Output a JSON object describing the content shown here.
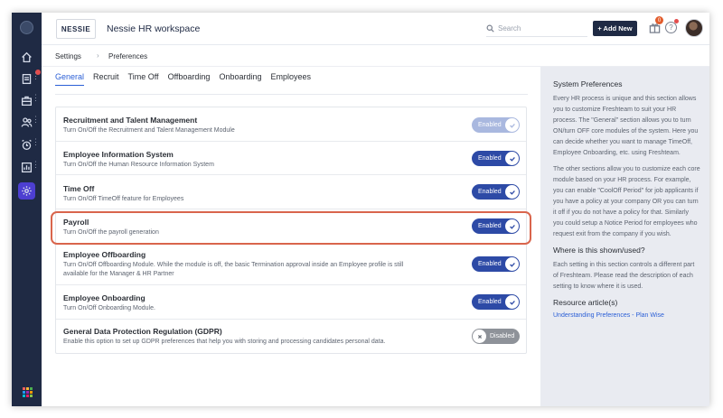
{
  "app": {
    "workspace_title": "Nessie HR workspace",
    "logo_text": "NESSIE"
  },
  "topbar": {
    "search_placeholder": "Search",
    "add_new_label": "+ Add New",
    "notification_count": "0",
    "help_glyph": "?"
  },
  "rail": {
    "icons": [
      "home-icon",
      "forms-icon",
      "briefcase-icon",
      "people-icon",
      "alarm-clock-icon",
      "report-icon",
      "settings-icon"
    ],
    "active": "settings-icon",
    "apps_grid_colors": [
      "#f25f5c",
      "#f7b538",
      "#4caf50",
      "#2196f3",
      "#9c27b0",
      "#ff9800",
      "#00bcd4",
      "#e91e63",
      "#8bc34a"
    ]
  },
  "breadcrumb": {
    "root": "Settings",
    "separator": "›",
    "current": "Preferences"
  },
  "tabs": [
    {
      "label": "General",
      "active": true
    },
    {
      "label": "Recruit",
      "active": false
    },
    {
      "label": "Time Off",
      "active": false
    },
    {
      "label": "Offboarding",
      "active": false
    },
    {
      "label": "Onboarding",
      "active": false
    },
    {
      "label": "Employees",
      "active": false
    }
  ],
  "settings": [
    {
      "title": "Recruitment and Talent Management",
      "desc": "Turn On/Off the Recruitment and Talent Management Module",
      "state": "Enabled",
      "style": "dim"
    },
    {
      "title": "Employee Information System",
      "desc": "Turn On/Off the Human Resource Information System",
      "state": "Enabled",
      "style": "on"
    },
    {
      "title": "Time Off",
      "desc": "Turn On/Off TimeOff feature for Employees",
      "state": "Enabled",
      "style": "on"
    },
    {
      "title": "Payroll",
      "desc": "Turn On/Off the payroll generation",
      "state": "Enabled",
      "style": "on"
    },
    {
      "title": "Employee Offboarding",
      "desc": "Turn On/Off Offboarding Module. While the module is off, the basic Termination approval inside an Employee profile is still available for the Manager & HR Partner",
      "state": "Enabled",
      "style": "on"
    },
    {
      "title": "Employee Onboarding",
      "desc": "Turn On/Off Onboarding Module.",
      "state": "Enabled",
      "style": "on"
    },
    {
      "title": "General Data Protection Regulation (GDPR)",
      "desc": "Enable this option to set up GDPR preferences that help you with storing and processing candidates personal data.",
      "state": "Disabled",
      "style": "off"
    }
  ],
  "colors": {
    "highlight": "#d9654c",
    "toggle_on": "#2d4aa6",
    "accent": "#2b5fd6",
    "rail": "#1f2a44"
  },
  "side": {
    "heading": "System Preferences",
    "para1": "Every HR process is unique and this section allows you to customize Freshteam to suit your HR process. The \"General\" section allows you to turn ON/turn OFF core modules of the system. Here you can decide whether you want to manage TimeOff, Employee Onboarding, etc. using Freshteam.",
    "para2": "The other sections allow you to customize each core module based on your HR process. For example, you can enable \"CoolOff Period\" for job applicants if you have a policy at your company OR you can turn it off if you do not have a policy for that. Similarly you could setup a Notice Period for employees who request exit from the company if you wish.",
    "where_heading": "Where is this shown/used?",
    "where_text": "Each setting in this section controls a different part of Freshteam. Please read the description of each setting to know where it is used.",
    "resource_heading": "Resource article(s)",
    "resource_link": "Understanding Preferences - Plan Wise"
  }
}
